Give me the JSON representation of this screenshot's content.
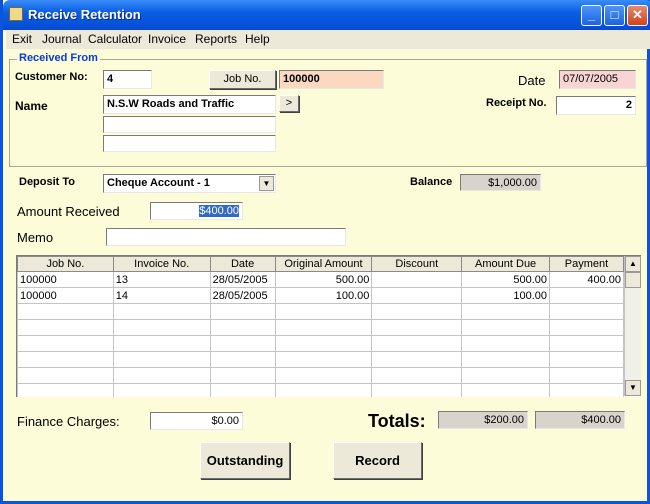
{
  "window": {
    "title": "Receive Retention"
  },
  "menu": [
    "Exit",
    "Journal",
    "Calculator",
    "Invoice",
    "Reports",
    "Help"
  ],
  "received_from": {
    "group_label": "Received From",
    "customer_no_label": "Customer No:",
    "customer_no": "4",
    "job_no_button": "Job No.",
    "job_no": "100000",
    "date_label": "Date",
    "date": "07/07/2005",
    "name_label": "Name",
    "name": "N.S.W Roads and Traffic",
    "name_line2": "",
    "name_line3": "",
    "lookup_button": ">",
    "receipt_no_label": "Receipt No.",
    "receipt_no": "2"
  },
  "deposit": {
    "label": "Deposit To",
    "account": "Cheque Account - 1",
    "balance_label": "Balance",
    "balance": "$1,000.00"
  },
  "amount": {
    "label": "Amount Received",
    "value": "$400.00"
  },
  "memo": {
    "label": "Memo",
    "value": ""
  },
  "table": {
    "columns": [
      "Job No.",
      "Invoice No.",
      "Date",
      "Original Amount",
      "Discount",
      "Amount Due",
      "Payment"
    ],
    "rows": [
      [
        "100000",
        "13",
        "28/05/2005",
        "500.00",
        "",
        "500.00",
        "400.00"
      ],
      [
        "100000",
        "14",
        "28/05/2005",
        "100.00",
        "",
        "100.00",
        ""
      ]
    ]
  },
  "footer": {
    "finance_label": "Finance Charges:",
    "finance_value": "$0.00",
    "totals_label": "Totals:",
    "total_due": "$200.00",
    "total_payment": "$400.00",
    "outstanding_button": "Outstanding",
    "record_button": "Record"
  },
  "colors": {
    "accent": "#0a3ccf",
    "window_bg": "#fcfcd8",
    "date_bg": "#f9d4d4",
    "job_bg": "#fbd8c0"
  },
  "icons": [
    "app-icon",
    "minimize-icon",
    "maximize-icon",
    "close-icon",
    "chevron-down-icon",
    "scroll-up-icon",
    "scroll-down-icon"
  ]
}
